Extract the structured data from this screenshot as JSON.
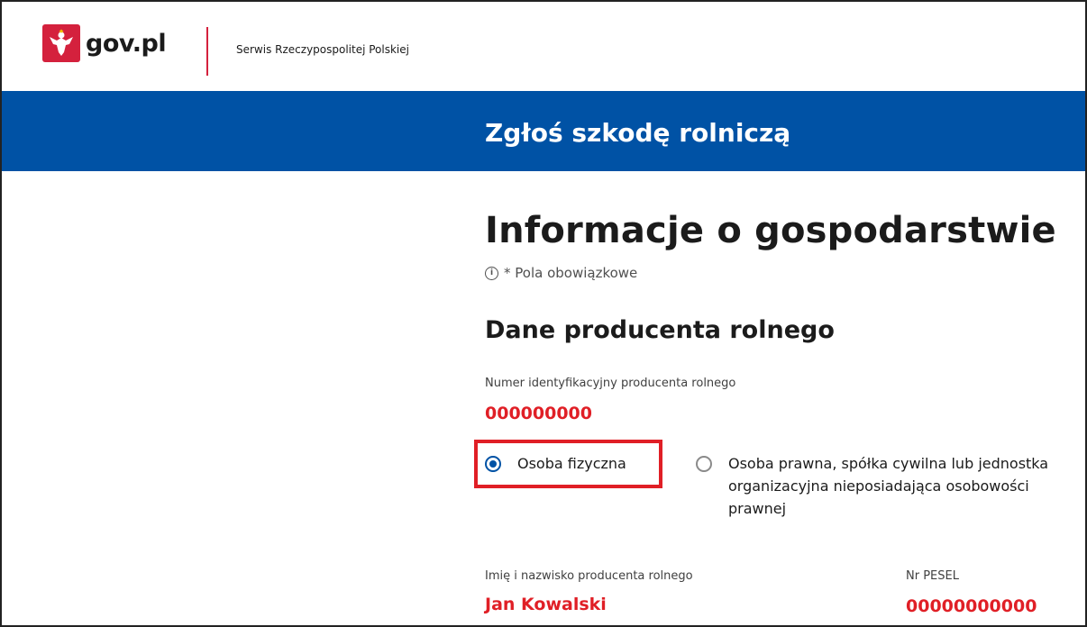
{
  "header": {
    "logo_text": "gov.pl",
    "service_name": "Serwis Rzeczypospolitej Polskiej",
    "logo_icon": "polish-eagle-emblem"
  },
  "banner": {
    "title": "Zgłoś szkodę rolniczą"
  },
  "page": {
    "title": "Informacje o gospodarstwie",
    "required_note": "* Pola obowiązkowe",
    "info_icon": "ⓘ"
  },
  "section": {
    "title": "Dane producenta rolnego"
  },
  "fields": {
    "farmer_id": {
      "label": "Numer identyfikacyjny producenta rolnego",
      "value": "000000000"
    },
    "person_type": {
      "options": [
        {
          "label": "Osoba fizyczna",
          "checked": true
        },
        {
          "label": "Osoba prawna, spółka cywilna lub jednostka organizacyjna nieposiadająca osobowości prawnej",
          "checked": false
        }
      ]
    },
    "name": {
      "label": "Imię i nazwisko producenta rolnego",
      "value": "Jan Kowalski"
    },
    "pesel": {
      "label": "Nr PESEL",
      "value": "00000000000"
    }
  },
  "colors": {
    "brand_blue": "#0052a5",
    "accent_red": "#e01f26",
    "emblem_red": "#d4213d"
  }
}
